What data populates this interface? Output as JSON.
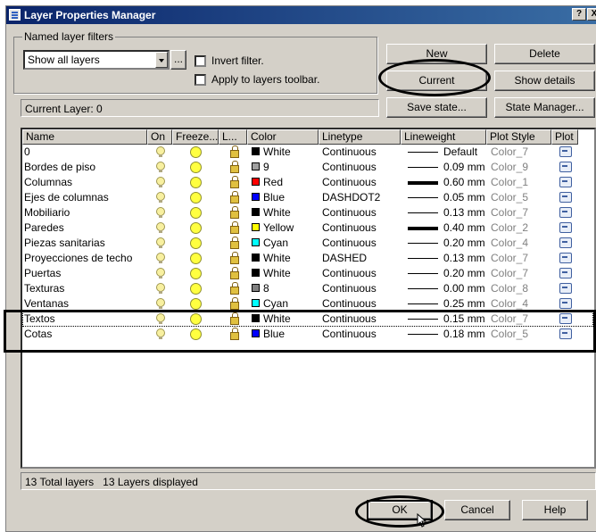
{
  "title": "Layer Properties Manager",
  "title_buttons": [
    "?",
    "X"
  ],
  "filters": {
    "group_label": "Named layer filters",
    "selected": "Show all layers",
    "browse_label": "...",
    "invert_label": "Invert filter.",
    "apply_label": "Apply to layers toolbar."
  },
  "buttons": {
    "new": "New",
    "delete": "Delete",
    "current": "Current",
    "show_details": "Show details",
    "save_state": "Save state...",
    "state_manager": "State Manager..."
  },
  "current_layer": "Current Layer: 0",
  "columns": [
    "Name",
    "On",
    "Freeze...",
    "L...",
    "Color",
    "Linetype",
    "Lineweight",
    "Plot Style",
    "Plot"
  ],
  "layers": [
    {
      "name": "0",
      "color": "White",
      "color_hex": "#000000",
      "linetype": "Continuous",
      "lineweight": "Default",
      "plot_style": "Color_7",
      "thick": false
    },
    {
      "name": "Bordes de piso",
      "color": "9",
      "color_hex": "#a0a0a0",
      "linetype": "Continuous",
      "lineweight": "0.09 mm",
      "plot_style": "Color_9",
      "thick": false
    },
    {
      "name": "Columnas",
      "color": "Red",
      "color_hex": "#ff0000",
      "linetype": "Continuous",
      "lineweight": "0.60 mm",
      "plot_style": "Color_1",
      "thick": true
    },
    {
      "name": "Ejes de columnas",
      "color": "Blue",
      "color_hex": "#0000ff",
      "linetype": "DASHDOT2",
      "lineweight": "0.05 mm",
      "plot_style": "Color_5",
      "thick": false
    },
    {
      "name": "Mobiliario",
      "color": "White",
      "color_hex": "#000000",
      "linetype": "Continuous",
      "lineweight": "0.13 mm",
      "plot_style": "Color_7",
      "thick": false
    },
    {
      "name": "Paredes",
      "color": "Yellow",
      "color_hex": "#ffff00",
      "linetype": "Continuous",
      "lineweight": "0.40 mm",
      "plot_style": "Color_2",
      "thick": true
    },
    {
      "name": "Piezas sanitarias",
      "color": "Cyan",
      "color_hex": "#00ffff",
      "linetype": "Continuous",
      "lineweight": "0.20 mm",
      "plot_style": "Color_4",
      "thick": false
    },
    {
      "name": "Proyecciones de techo",
      "color": "White",
      "color_hex": "#000000",
      "linetype": "DASHED",
      "lineweight": "0.13 mm",
      "plot_style": "Color_7",
      "thick": false
    },
    {
      "name": "Puertas",
      "color": "White",
      "color_hex": "#000000",
      "linetype": "Continuous",
      "lineweight": "0.20 mm",
      "plot_style": "Color_7",
      "thick": false
    },
    {
      "name": "Texturas",
      "color": "8",
      "color_hex": "#808080",
      "linetype": "Continuous",
      "lineweight": "0.00 mm",
      "plot_style": "Color_8",
      "thick": false
    },
    {
      "name": "Ventanas",
      "color": "Cyan",
      "color_hex": "#00ffff",
      "linetype": "Continuous",
      "lineweight": "0.25 mm",
      "plot_style": "Color_4",
      "thick": false
    },
    {
      "name": "Textos",
      "color": "White",
      "color_hex": "#000000",
      "linetype": "Continuous",
      "lineweight": "0.15 mm",
      "plot_style": "Color_7",
      "thick": false
    },
    {
      "name": "Cotas",
      "color": "Blue",
      "color_hex": "#0000ff",
      "linetype": "Continuous",
      "lineweight": "0.18 mm",
      "plot_style": "Color_5",
      "thick": false
    }
  ],
  "status": "13 Total layers   13 Layers displayed",
  "footer": {
    "ok": "OK",
    "cancel": "Cancel",
    "help": "Help"
  }
}
